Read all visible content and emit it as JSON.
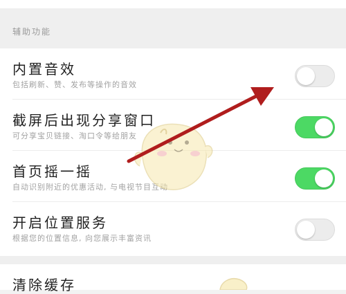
{
  "section": {
    "header": "辅助功能"
  },
  "settings": [
    {
      "title": "内置音效",
      "description": "包括刷新、赞、发布等操作的音效",
      "enabled": false
    },
    {
      "title": "截屏后出现分享窗口",
      "description": "可分享宝贝链接、淘口令等给朋友",
      "enabled": true
    },
    {
      "title": "首页摇一摇",
      "description": "自动识别附近的优惠活动, 与电视节目互动",
      "enabled": true
    },
    {
      "title": "开启位置服务",
      "description": "根据您的位置信息, 向您展示丰富资讯",
      "enabled": false
    }
  ],
  "cache": {
    "title": "清除缓存"
  },
  "colors": {
    "toggle_on": "#4cd964",
    "toggle_off": "#ececec",
    "arrow": "#b01d1d"
  }
}
